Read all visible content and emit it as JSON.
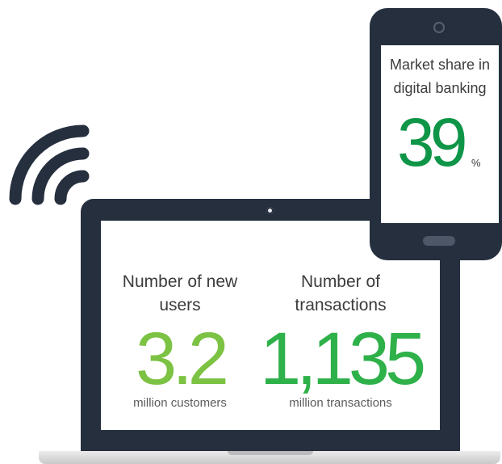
{
  "colors": {
    "device_dark": "#252f3e",
    "green_light": "#7cc243",
    "green_mid": "#2fb14a",
    "green_dark": "#0e9547"
  },
  "icons": {
    "wifi": "wifi-icon"
  },
  "phone": {
    "label": "Market share in digital banking",
    "value": "39",
    "unit": "%"
  },
  "laptop": {
    "stats": [
      {
        "label": "Number of new users",
        "value": "3.2",
        "unit": "million customers"
      },
      {
        "label": "Number of transactions",
        "value": "1,135",
        "unit": "million transactions"
      }
    ]
  }
}
